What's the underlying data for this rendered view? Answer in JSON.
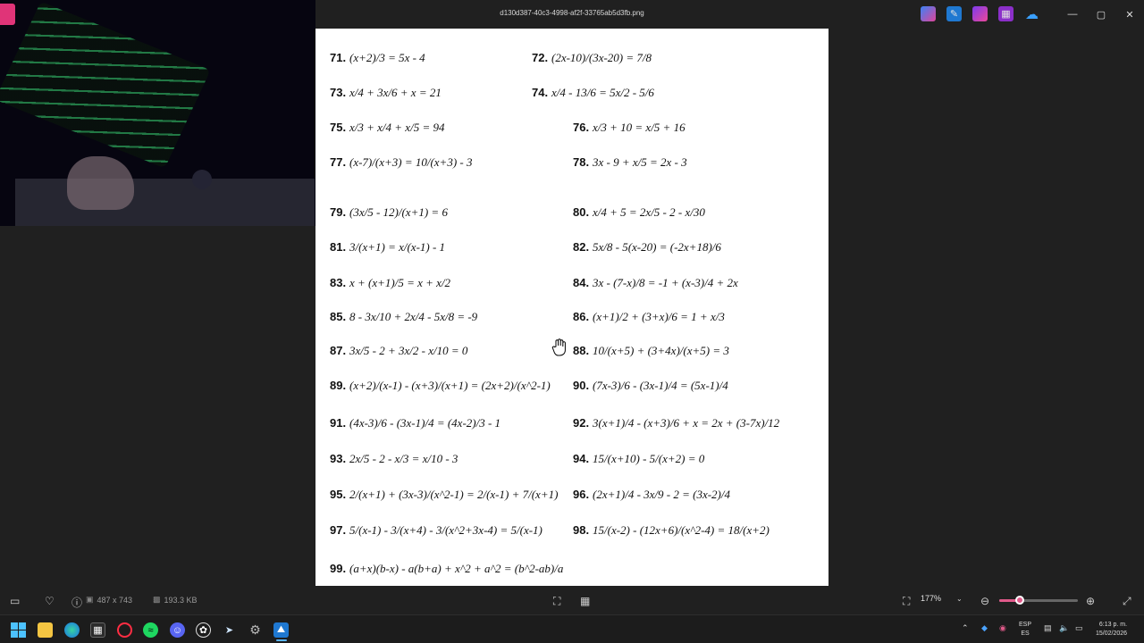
{
  "window": {
    "title": "d130d387-40c3-4998-af2f-33765ab5d3fb.png"
  },
  "window_controls": {
    "minimize": "—",
    "maximize": "▢",
    "close": "✕"
  },
  "toolbar_icons": [
    "copilot-icon",
    "photo-editor-icon",
    "clipchamp-icon",
    "designer-icon",
    "onedrive-icon"
  ],
  "status": {
    "dimensions": "487 x 743",
    "file_size": "193.3 KB",
    "zoom": "177%"
  },
  "zoom_slider": {
    "value_fraction": 0.26
  },
  "problems": [
    {
      "num": "71.",
      "expr": "(x+2)/3 = 5x - 4"
    },
    {
      "num": "72.",
      "expr": "(2x-10)/(3x-20) = 7/8"
    },
    {
      "num": "73.",
      "expr": "x/4 + 3x/6 + x = 21"
    },
    {
      "num": "74.",
      "expr": "x/4 - 13/6 = 5x/2 - 5/6"
    },
    {
      "num": "75.",
      "expr": "x/3 + x/4 + x/5 = 94"
    },
    {
      "num": "76.",
      "expr": "x/3 + 10 = x/5 + 16"
    },
    {
      "num": "77.",
      "expr": "(x-7)/(x+3) = 10/(x+3) - 3"
    },
    {
      "num": "78.",
      "expr": "3x - 9 + x/5 = 2x - 3"
    },
    {
      "num": "79.",
      "expr": "(3x/5 - 12)/(x+1) = 6"
    },
    {
      "num": "80.",
      "expr": "x/4 + 5 = 2x/5 - 2 - x/30"
    },
    {
      "num": "81.",
      "expr": "3/(x+1) = x/(x-1) - 1"
    },
    {
      "num": "82.",
      "expr": "5x/8 - 5(x-20) = (-2x+18)/6"
    },
    {
      "num": "83.",
      "expr": "x + (x+1)/5 = x + x/2"
    },
    {
      "num": "84.",
      "expr": "3x - (7-x)/8 = -1 + (x-3)/4 + 2x"
    },
    {
      "num": "85.",
      "expr": "8 - 3x/10 + 2x/4 - 5x/8 = -9"
    },
    {
      "num": "86.",
      "expr": "(x+1)/2 + (3+x)/6 = 1 + x/3"
    },
    {
      "num": "87.",
      "expr": "3x/5 - 2 + 3x/2 - x/10 = 0"
    },
    {
      "num": "88.",
      "expr": "10/(x+5) + (3+4x)/(x+5) = 3"
    },
    {
      "num": "89.",
      "expr": "(x+2)/(x-1) - (x+3)/(x+1) = (2x+2)/(x^2-1)"
    },
    {
      "num": "90.",
      "expr": "(7x-3)/6 - (3x-1)/4 = (5x-1)/4"
    },
    {
      "num": "91.",
      "expr": "(4x-3)/6 - (3x-1)/4 = (4x-2)/3 - 1"
    },
    {
      "num": "92.",
      "expr": "3(x+1)/4 - (x+3)/6 + x = 2x + (3-7x)/12"
    },
    {
      "num": "93.",
      "expr": "2x/5 - 2 - x/3 = x/10 - 3"
    },
    {
      "num": "94.",
      "expr": "15/(x+10) - 5/(x+2) = 0"
    },
    {
      "num": "95.",
      "expr": "2/(x+1) + (3x-3)/(x^2-1) = 2/(x-1) + 7/(x+1)"
    },
    {
      "num": "96.",
      "expr": "(2x+1)/4 - 3x/9 - 2 = (3x-2)/4"
    },
    {
      "num": "97.",
      "expr": "5/(x-1) - 3/(x+4) - 3/(x^2+3x-4) = 5/(x-1)"
    },
    {
      "num": "98.",
      "expr": "15/(x-2) - (12x+6)/(x^2-4) = 18/(x+2)"
    },
    {
      "num": "99.",
      "expr": "(a+x)(b-x) - a(b+a) + x^2 + a^2 = (b^2-ab)/a"
    }
  ],
  "taskbar": {
    "apps": [
      "start-icon",
      "file-explorer-icon",
      "edge-icon",
      "store-icon",
      "opera-icon",
      "spotify-icon",
      "discord-icon",
      "chatgpt-icon",
      "steam-icon",
      "settings-icon",
      "photos-icon"
    ],
    "language": {
      "line1": "ESP",
      "line2": "ES"
    },
    "time": "6:13 p. m.",
    "date": "15/02/2026"
  }
}
